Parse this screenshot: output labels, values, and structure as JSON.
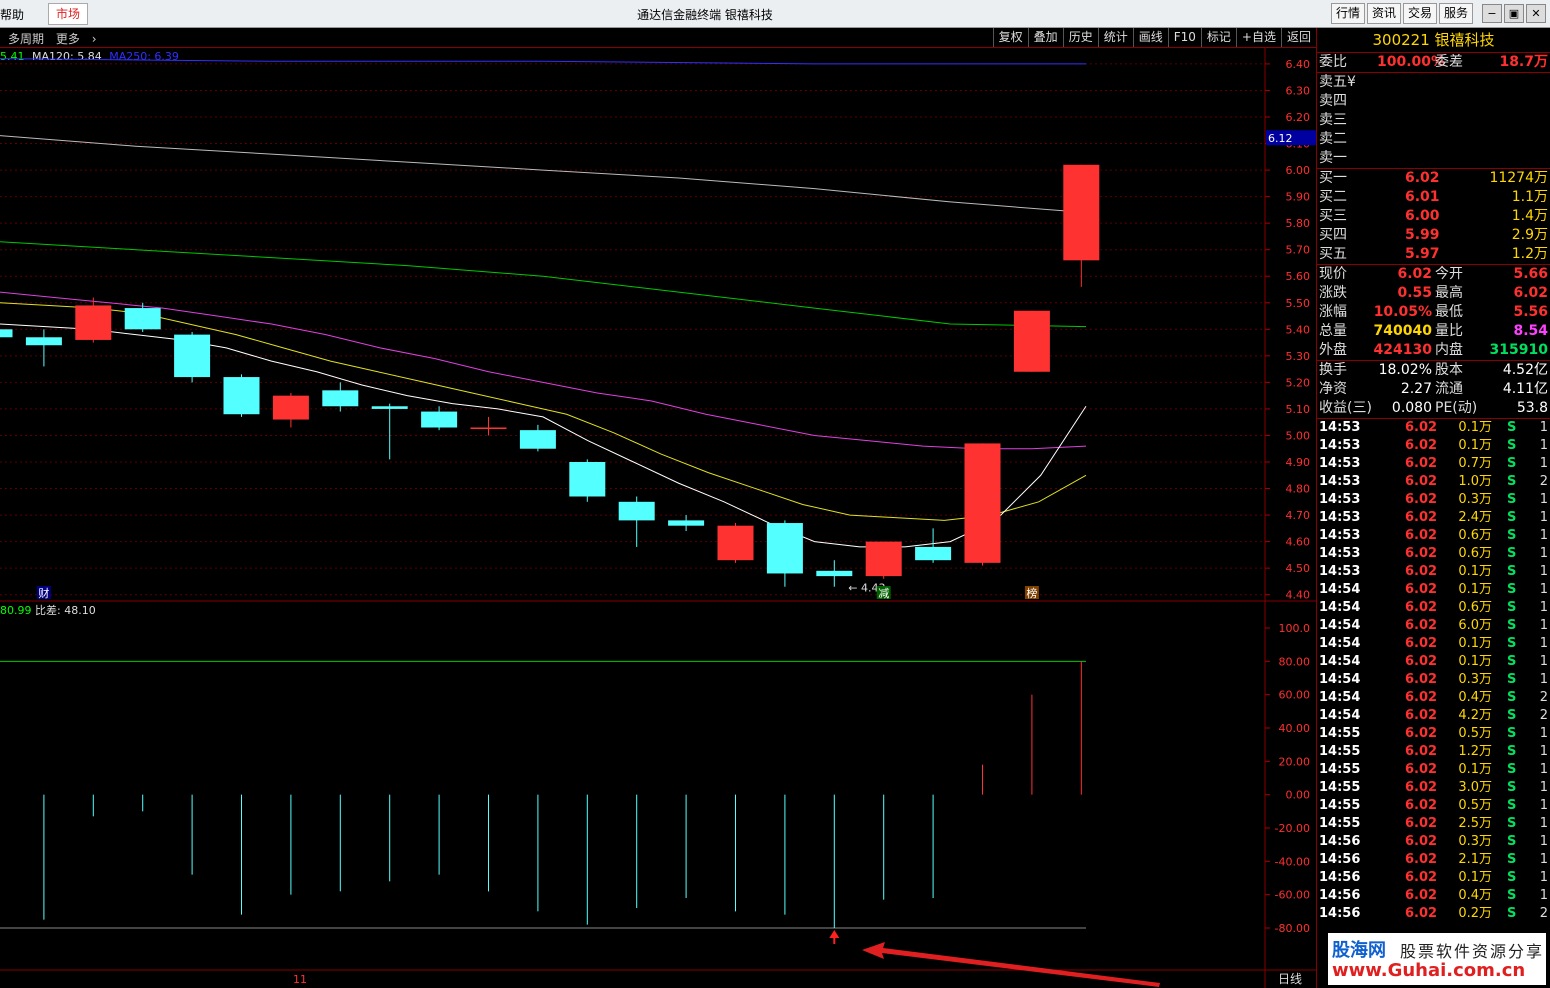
{
  "titlebar": {
    "help": "帮助",
    "market": "市场",
    "title": "通达信金融终端 银禧科技",
    "buttons": [
      "行情",
      "资讯",
      "交易",
      "服务"
    ],
    "win": [
      "−",
      "▣",
      "✕"
    ]
  },
  "toolbar": {
    "period": "多周期",
    "more": "更多",
    "tools": [
      "复权",
      "叠加",
      "历史",
      "统计",
      "画线",
      "F10",
      "标记",
      "+自选",
      "返回"
    ]
  },
  "ma_legend": {
    "ma_short": "5.41",
    "ma120": "MA120: 5.84",
    "ma250": "MA250: 6.39",
    "colors": {
      "short": "#00ff00",
      "ma120": "#dddddd",
      "ma250": "#3030ff"
    }
  },
  "price_axis": {
    "ticks": [
      "6.40",
      "6.30",
      "6.20",
      "6.10",
      "6.00",
      "5.90",
      "5.80",
      "5.70",
      "5.60",
      "5.50",
      "5.40",
      "5.30",
      "5.20",
      "5.10",
      "5.00",
      "4.90",
      "4.80",
      "4.70",
      "4.60",
      "4.50",
      "4.40"
    ],
    "current_marker": "6.12"
  },
  "low_label": "4.43",
  "event_markers": [
    "财",
    "减",
    "榜"
  ],
  "indicator": {
    "legend_value": "80.99",
    "legend_label": "比差: 48.10",
    "axis_ticks": [
      "100.0",
      "80.00",
      "60.00",
      "40.00",
      "20.00",
      "0.00",
      "-20.00",
      "-40.00",
      "-60.00",
      "-80.00"
    ],
    "bars": [
      -75,
      -13,
      -10,
      -48,
      -72,
      -60,
      -58,
      -52,
      -48,
      -58,
      -70,
      -78,
      -68,
      -62,
      -70,
      -72,
      -80,
      -63,
      -62,
      18,
      60,
      80
    ]
  },
  "bottom_axis": {
    "month": "11",
    "period": "日线"
  },
  "chart_data": {
    "type": "candlestick",
    "ylim": [
      4.38,
      6.46
    ],
    "candles": [
      {
        "o": 5.4,
        "c": 5.37,
        "h": 5.4,
        "l": 5.36
      },
      {
        "o": 5.37,
        "c": 5.34,
        "h": 5.4,
        "l": 5.26
      },
      {
        "o": 5.36,
        "c": 5.49,
        "h": 5.52,
        "l": 5.35
      },
      {
        "o": 5.48,
        "c": 5.4,
        "h": 5.5,
        "l": 5.39
      },
      {
        "o": 5.38,
        "c": 5.22,
        "h": 5.39,
        "l": 5.2
      },
      {
        "o": 5.22,
        "c": 5.08,
        "h": 5.23,
        "l": 5.07
      },
      {
        "o": 5.06,
        "c": 5.15,
        "h": 5.16,
        "l": 5.03
      },
      {
        "o": 5.17,
        "c": 5.11,
        "h": 5.2,
        "l": 5.09
      },
      {
        "o": 5.11,
        "c": 5.1,
        "h": 5.12,
        "l": 4.91
      },
      {
        "o": 5.09,
        "c": 5.03,
        "h": 5.11,
        "l": 5.02
      },
      {
        "o": 5.03,
        "c": 5.03,
        "h": 5.07,
        "l": 5.0
      },
      {
        "o": 5.02,
        "c": 4.95,
        "h": 5.04,
        "l": 4.94
      },
      {
        "o": 4.9,
        "c": 4.77,
        "h": 4.91,
        "l": 4.75
      },
      {
        "o": 4.75,
        "c": 4.68,
        "h": 4.77,
        "l": 4.58
      },
      {
        "o": 4.68,
        "c": 4.66,
        "h": 4.7,
        "l": 4.64
      },
      {
        "o": 4.53,
        "c": 4.66,
        "h": 4.67,
        "l": 4.52
      },
      {
        "o": 4.67,
        "c": 4.48,
        "h": 4.68,
        "l": 4.43
      },
      {
        "o": 4.49,
        "c": 4.47,
        "h": 4.53,
        "l": 4.43
      },
      {
        "o": 4.47,
        "c": 4.6,
        "h": 4.6,
        "l": 4.46
      },
      {
        "o": 4.58,
        "c": 4.53,
        "h": 4.65,
        "l": 4.52
      },
      {
        "o": 4.52,
        "c": 4.97,
        "h": 4.97,
        "l": 4.51
      },
      {
        "o": 5.24,
        "c": 5.47,
        "h": 5.47,
        "l": 5.24
      },
      {
        "o": 5.66,
        "c": 6.02,
        "h": 6.02,
        "l": 5.56
      }
    ],
    "ma_white": [
      5.42,
      5.41,
      5.4,
      5.38,
      5.36,
      5.33,
      5.28,
      5.24,
      5.19,
      5.15,
      5.12,
      5.1,
      5.07,
      4.98,
      4.9,
      4.82,
      4.75,
      4.67,
      4.6,
      4.58,
      4.58,
      4.6,
      4.68,
      4.85,
      5.11
    ],
    "ma_yellow": [
      5.5,
      5.49,
      5.48,
      5.46,
      5.42,
      5.38,
      5.33,
      5.28,
      5.24,
      5.2,
      5.16,
      5.12,
      5.08,
      5.01,
      4.93,
      4.86,
      4.8,
      4.74,
      4.7,
      4.69,
      4.68,
      4.7,
      4.75,
      4.85
    ],
    "ma_magenta": [
      5.54,
      5.52,
      5.5,
      5.48,
      5.45,
      5.42,
      5.38,
      5.33,
      5.29,
      5.24,
      5.2,
      5.16,
      5.13,
      5.08,
      5.04,
      5.0,
      4.98,
      4.96,
      4.95,
      4.95,
      4.96
    ],
    "ma120": [
      6.13,
      6.09,
      6.06,
      6.03,
      6.0,
      5.97,
      5.93,
      5.88,
      5.84
    ],
    "ma250": [
      6.42,
      6.41,
      6.41,
      6.4,
      6.4
    ],
    "ma_green": [
      5.73,
      5.7,
      5.67,
      5.64,
      5.6,
      5.54,
      5.48,
      5.42,
      5.41
    ]
  },
  "quote": {
    "header": "300221 银禧科技",
    "weibi_label": "委比",
    "weibi": "100.00%",
    "weicha_label": "委差",
    "weicha": "18.7万",
    "sell": [
      {
        "label": "卖五",
        "extra": "¥"
      },
      {
        "label": "卖四"
      },
      {
        "label": "卖三"
      },
      {
        "label": "卖二"
      },
      {
        "label": "卖一"
      }
    ],
    "buy": [
      {
        "label": "买一",
        "price": "6.02",
        "vol": "11274万"
      },
      {
        "label": "买二",
        "price": "6.01",
        "vol": "1.1万"
      },
      {
        "label": "买三",
        "price": "6.00",
        "vol": "1.4万"
      },
      {
        "label": "买四",
        "price": "5.99",
        "vol": "2.9万"
      },
      {
        "label": "买五",
        "price": "5.97",
        "vol": "1.2万"
      }
    ],
    "stats": [
      {
        "l1": "现价",
        "v1": "6.02",
        "c1": "#ff3030",
        "l2": "今开",
        "v2": "5.66",
        "c2": "#ff3030"
      },
      {
        "l1": "涨跌",
        "v1": "0.55",
        "c1": "#ff3030",
        "l2": "最高",
        "v2": "6.02",
        "c2": "#ff3030"
      },
      {
        "l1": "涨幅",
        "v1": "10.05%",
        "c1": "#ff3030",
        "l2": "最低",
        "v2": "5.56",
        "c2": "#ff3030"
      },
      {
        "l1": "总量",
        "v1": "740040",
        "c1": "#ffd700",
        "l2": "量比",
        "v2": "8.54",
        "c2": "#ff40ff"
      },
      {
        "l1": "外盘",
        "v1": "424130",
        "c1": "#ff3030",
        "l2": "内盘",
        "v2": "315910",
        "c2": "#00e060"
      }
    ],
    "stats2": [
      {
        "l1": "换手",
        "v1": "18.02%",
        "l2": "股本",
        "v2": "4.52亿"
      },
      {
        "l1": "净资",
        "v1": "2.27",
        "l2": "流通",
        "v2": "4.11亿"
      },
      {
        "l1": "收益(三)",
        "v1": "0.080",
        "l2": "PE(动)",
        "v2": "53.8"
      }
    ],
    "ticks": [
      {
        "t": "14:53",
        "p": "6.02",
        "v": "0.1万",
        "s": "S",
        "n": "1"
      },
      {
        "t": "14:53",
        "p": "6.02",
        "v": "0.1万",
        "s": "S",
        "n": "1"
      },
      {
        "t": "14:53",
        "p": "6.02",
        "v": "0.7万",
        "s": "S",
        "n": "1"
      },
      {
        "t": "14:53",
        "p": "6.02",
        "v": "1.0万",
        "s": "S",
        "n": "2"
      },
      {
        "t": "14:53",
        "p": "6.02",
        "v": "0.3万",
        "s": "S",
        "n": "1"
      },
      {
        "t": "14:53",
        "p": "6.02",
        "v": "2.4万",
        "s": "S",
        "n": "1"
      },
      {
        "t": "14:53",
        "p": "6.02",
        "v": "0.6万",
        "s": "S",
        "n": "1"
      },
      {
        "t": "14:53",
        "p": "6.02",
        "v": "0.6万",
        "s": "S",
        "n": "1"
      },
      {
        "t": "14:53",
        "p": "6.02",
        "v": "0.1万",
        "s": "S",
        "n": "1"
      },
      {
        "t": "14:54",
        "p": "6.02",
        "v": "0.1万",
        "s": "S",
        "n": "1"
      },
      {
        "t": "14:54",
        "p": "6.02",
        "v": "0.6万",
        "s": "S",
        "n": "1"
      },
      {
        "t": "14:54",
        "p": "6.02",
        "v": "6.0万",
        "s": "S",
        "n": "1"
      },
      {
        "t": "14:54",
        "p": "6.02",
        "v": "0.1万",
        "s": "S",
        "n": "1"
      },
      {
        "t": "14:54",
        "p": "6.02",
        "v": "0.1万",
        "s": "S",
        "n": "1"
      },
      {
        "t": "14:54",
        "p": "6.02",
        "v": "0.3万",
        "s": "S",
        "n": "1"
      },
      {
        "t": "14:54",
        "p": "6.02",
        "v": "0.4万",
        "s": "S",
        "n": "2"
      },
      {
        "t": "14:54",
        "p": "6.02",
        "v": "4.2万",
        "s": "S",
        "n": "2"
      },
      {
        "t": "14:55",
        "p": "6.02",
        "v": "0.5万",
        "s": "S",
        "n": "1"
      },
      {
        "t": "14:55",
        "p": "6.02",
        "v": "1.2万",
        "s": "S",
        "n": "1"
      },
      {
        "t": "14:55",
        "p": "6.02",
        "v": "0.1万",
        "s": "S",
        "n": "1"
      },
      {
        "t": "14:55",
        "p": "6.02",
        "v": "3.0万",
        "s": "S",
        "n": "1"
      },
      {
        "t": "14:55",
        "p": "6.02",
        "v": "0.5万",
        "s": "S",
        "n": "1"
      },
      {
        "t": "14:55",
        "p": "6.02",
        "v": "2.5万",
        "s": "S",
        "n": "1"
      },
      {
        "t": "14:56",
        "p": "6.02",
        "v": "0.3万",
        "s": "S",
        "n": "1"
      },
      {
        "t": "14:56",
        "p": "6.02",
        "v": "2.1万",
        "s": "S",
        "n": "1"
      },
      {
        "t": "14:56",
        "p": "6.02",
        "v": "0.1万",
        "s": "S",
        "n": "1"
      },
      {
        "t": "14:56",
        "p": "6.02",
        "v": "0.4万",
        "s": "S",
        "n": "1"
      },
      {
        "t": "14:56",
        "p": "6.02",
        "v": "0.2万",
        "s": "S",
        "n": "2"
      }
    ]
  },
  "watermark": {
    "brand": "股海网",
    "slogan": "股票软件资源分享",
    "url": "www.Guhai.com.cn"
  }
}
